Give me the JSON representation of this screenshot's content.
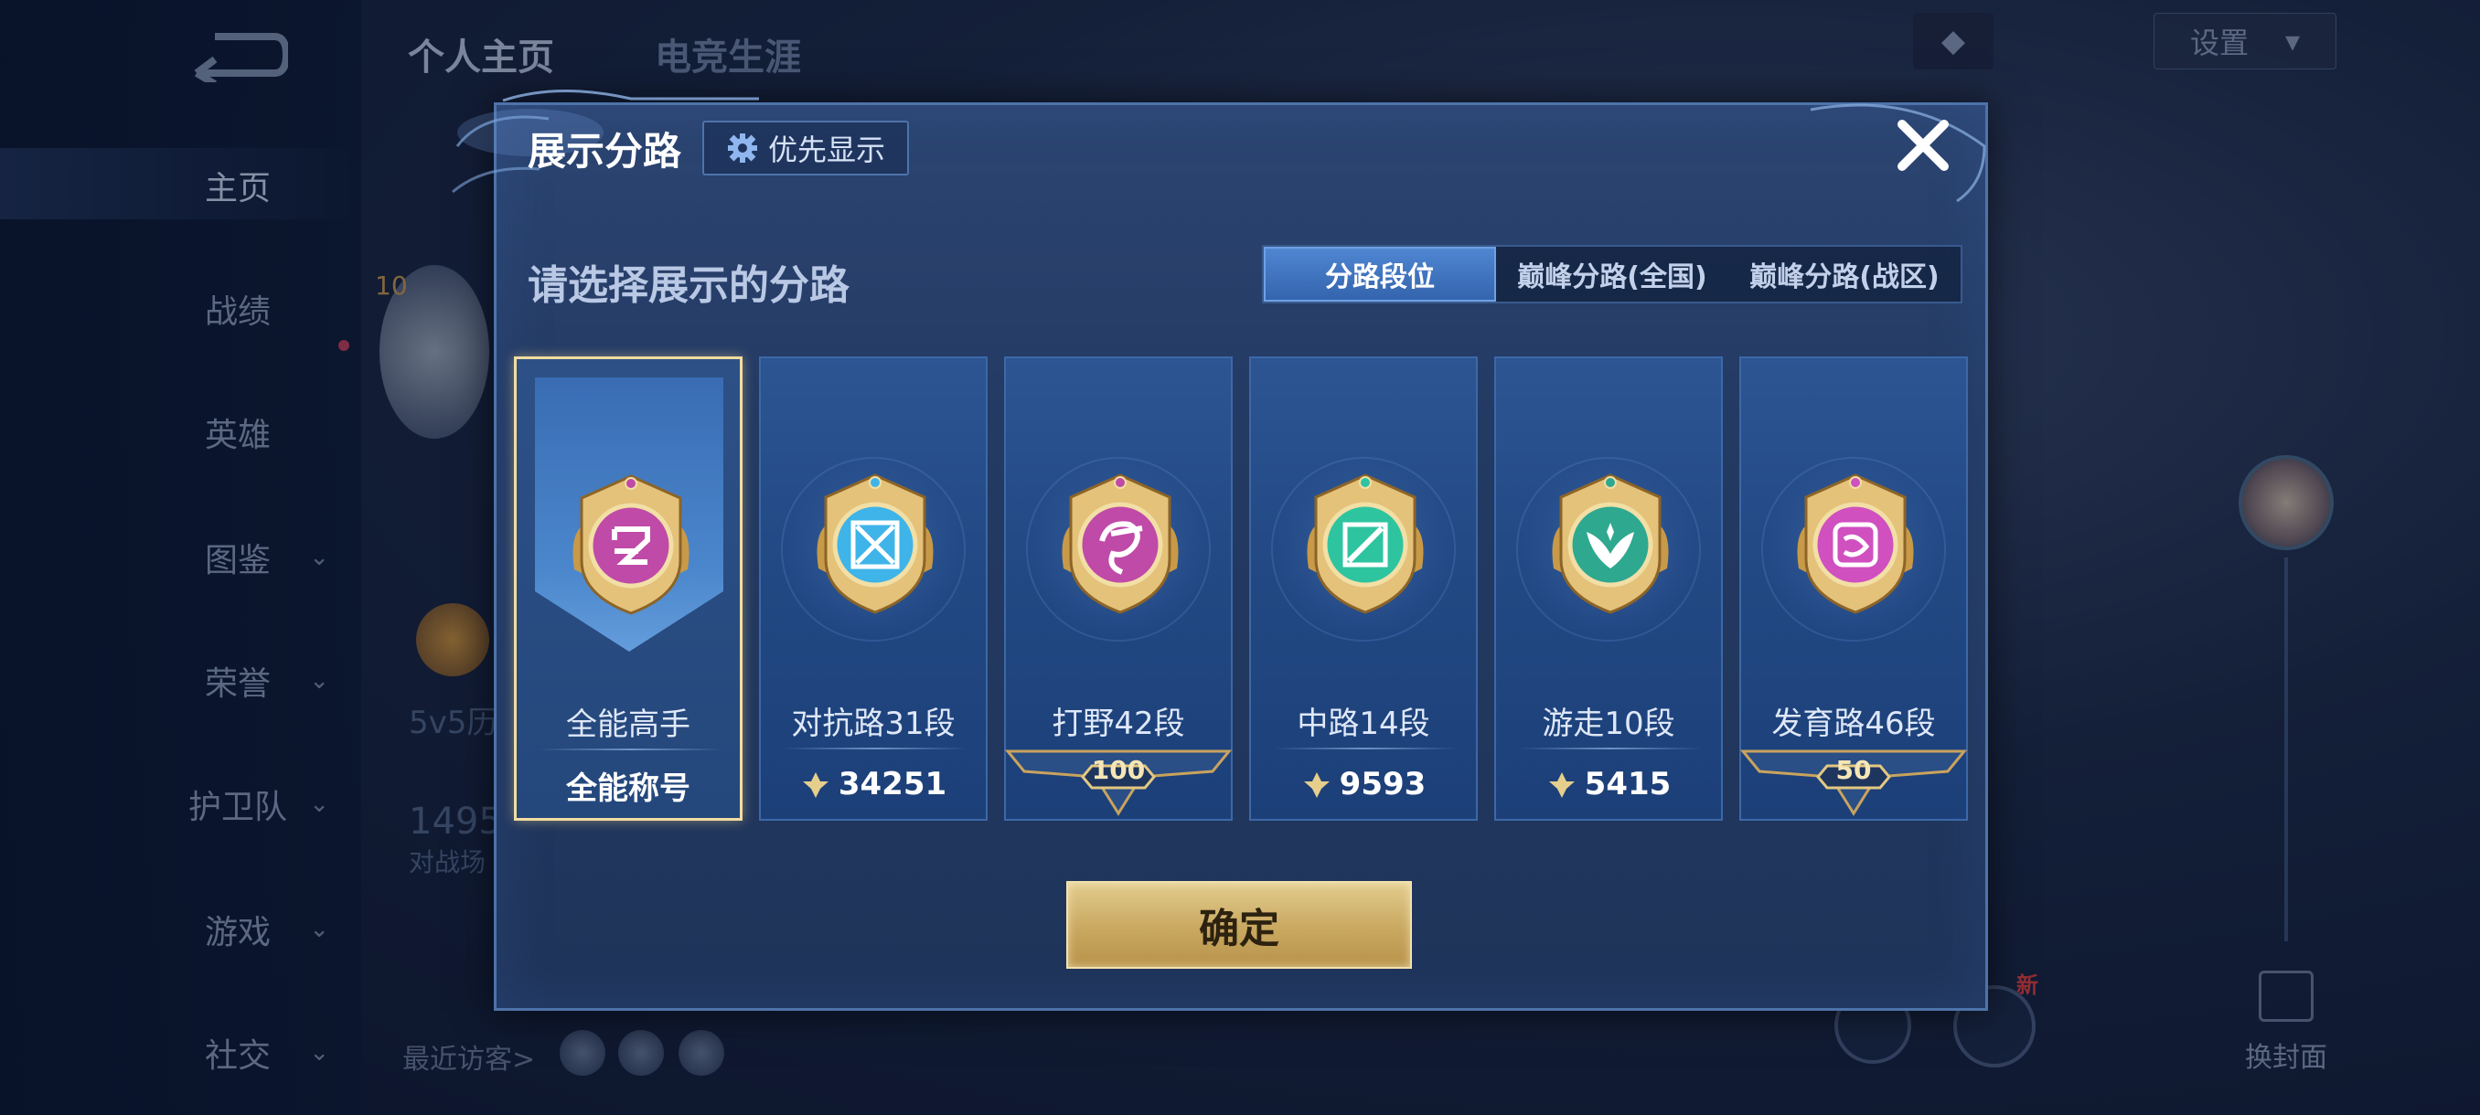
{
  "background": {
    "nav": [
      {
        "label": "主页",
        "active": true,
        "chevron": false
      },
      {
        "label": "战绩",
        "active": false,
        "chevron": false
      },
      {
        "label": "英雄",
        "active": false,
        "chevron": false
      },
      {
        "label": "图鉴",
        "active": false,
        "chevron": true
      },
      {
        "label": "荣誉",
        "active": false,
        "chevron": true
      },
      {
        "label": "护卫队",
        "active": false,
        "chevron": true
      },
      {
        "label": "游戏",
        "active": false,
        "chevron": true
      },
      {
        "label": "社交",
        "active": false,
        "chevron": true
      }
    ],
    "tabs": [
      "个人主页",
      "电竞生涯"
    ],
    "settings_label": "设置",
    "level_badge": "10",
    "mode_text": "5v5历",
    "count_text": "1495",
    "battle_text": "对战场",
    "visitors_label": "最近访客>",
    "new_badge": "新",
    "swap_cover_label": "换封面"
  },
  "modal": {
    "title": "展示分路",
    "priority_label": "优先显示",
    "subtitle": "请选择展示的分路",
    "tabs": [
      {
        "label": "分路段位",
        "active": true
      },
      {
        "label": "巅峰分路(全国)",
        "active": false
      },
      {
        "label": "巅峰分路(战区)",
        "active": false
      }
    ],
    "cards": [
      {
        "role": "全能高手",
        "stat": "全能称号",
        "stat_type": "title",
        "emblem": "all-round-emblem",
        "color": "#c04aa8",
        "selected": true
      },
      {
        "role": "对抗路31段",
        "stat": "34251",
        "stat_type": "points",
        "emblem": "clash-lane-emblem",
        "color": "#3fb4e8",
        "selected": false
      },
      {
        "role": "打野42段",
        "stat": "100",
        "stat_type": "rank",
        "emblem": "jungle-emblem",
        "color": "#c04aa8",
        "selected": false
      },
      {
        "role": "中路14段",
        "stat": "9593",
        "stat_type": "points",
        "emblem": "mid-lane-emblem",
        "color": "#2fc4a0",
        "selected": false
      },
      {
        "role": "游走10段",
        "stat": "5415",
        "stat_type": "points",
        "emblem": "roam-emblem",
        "color": "#2fa890",
        "selected": false
      },
      {
        "role": "发育路46段",
        "stat": "50",
        "stat_type": "rank",
        "emblem": "farm-lane-emblem",
        "color": "#d050c0",
        "selected": false
      }
    ],
    "confirm_label": "确定"
  }
}
